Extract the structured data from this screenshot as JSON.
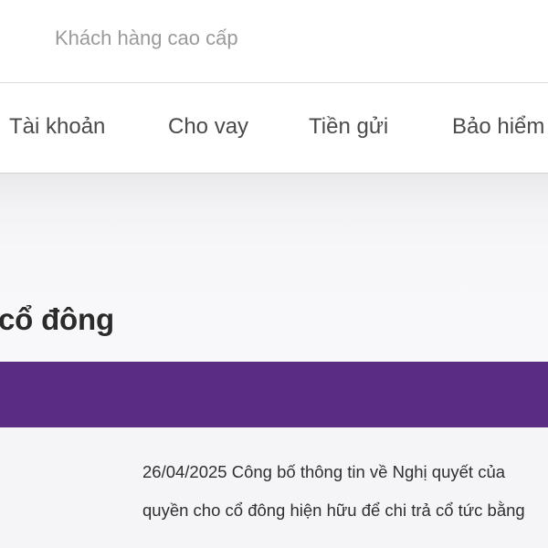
{
  "top_bar": {
    "segment_link": "Khách hàng cao cấp"
  },
  "nav": {
    "items": [
      {
        "label": "Tài khoản"
      },
      {
        "label": "Cho vay"
      },
      {
        "label": "Tiền gửi"
      },
      {
        "label": "Bảo hiểm"
      }
    ]
  },
  "main": {
    "title": "cổ đông",
    "announcements": [
      {
        "line1": "26/04/2025 Công bố thông tin về Nghị quyết của",
        "line2": "quyền cho cổ đông hiện hữu để chi trả cổ tức bằng"
      }
    ]
  },
  "colors": {
    "brand_purple": "#5b2c83",
    "nav_text": "#4a4a4a",
    "muted_text": "#9a9a9a",
    "content_bg": "#f5f5f8"
  }
}
